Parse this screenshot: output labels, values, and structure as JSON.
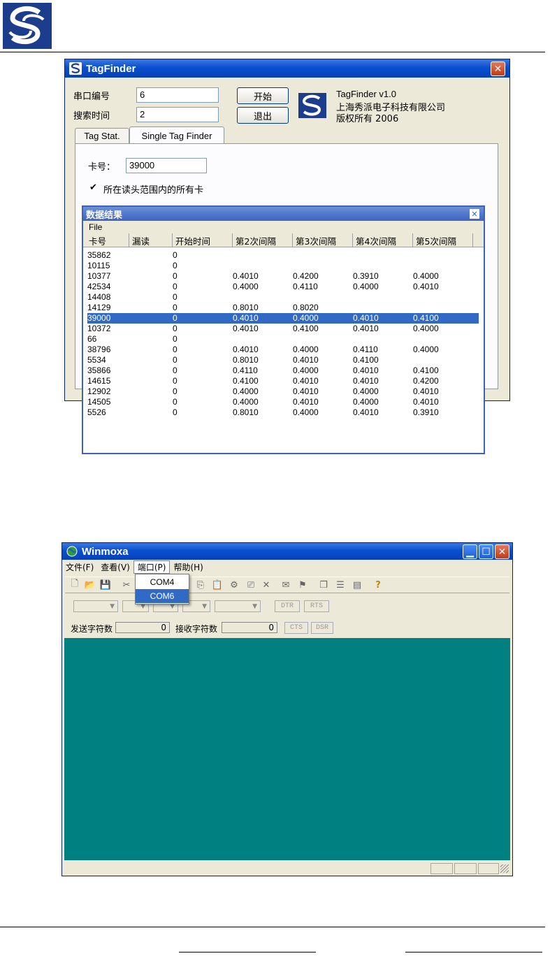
{
  "tagfinder": {
    "title": "TagFinder",
    "port_label": "串口编号",
    "port_value": "6",
    "search_time_label": "搜索时间",
    "search_time_value": "2",
    "start_button": "开始",
    "exit_button": "退出",
    "about_version": "TagFinder v1.0",
    "about_company": "上海秀派电子科技有限公司",
    "about_copyright": "版权所有 2006",
    "tabs": [
      "Tag Stat.",
      "Single Tag Finder"
    ],
    "card_label": "卡号：",
    "card_value": "39000",
    "checkbox_label": "所在读头范围内的所有卡"
  },
  "results": {
    "title": "数据结果",
    "menu_file": "File",
    "columns": [
      "卡号",
      "漏读",
      "开始时间",
      "第2次间隔",
      "第3次间隔",
      "第4次间隔",
      "第5次间隔"
    ],
    "rows": [
      [
        "35862",
        "",
        "0",
        "",
        "",
        "",
        ""
      ],
      [
        "10115",
        "",
        "0",
        "",
        "",
        "",
        ""
      ],
      [
        "10377",
        "",
        "0",
        "0.4010",
        "0.4200",
        "0.3910",
        "0.4000"
      ],
      [
        "42534",
        "",
        "0",
        "0.4000",
        "0.4110",
        "0.4000",
        "0.4010"
      ],
      [
        "14408",
        "",
        "0",
        "",
        "",
        "",
        ""
      ],
      [
        "14129",
        "",
        "0",
        "0.8010",
        "0.8020",
        "",
        ""
      ],
      [
        "39000",
        "",
        "0",
        "0.4010",
        "0.4000",
        "0.4010",
        "0.4100"
      ],
      [
        "10372",
        "",
        "0",
        "0.4010",
        "0.4100",
        "0.4010",
        "0.4000"
      ],
      [
        "66",
        "",
        "0",
        "",
        "",
        "",
        ""
      ],
      [
        "38796",
        "",
        "0",
        "0.4010",
        "0.4000",
        "0.4110",
        "0.4000"
      ],
      [
        "5534",
        "",
        "0",
        "0.8010",
        "0.4010",
        "0.4100",
        ""
      ],
      [
        "35866",
        "",
        "0",
        "0.4110",
        "0.4000",
        "0.4010",
        "0.4100"
      ],
      [
        "14615",
        "",
        "0",
        "0.4100",
        "0.4010",
        "0.4010",
        "0.4200"
      ],
      [
        "12902",
        "",
        "0",
        "0.4000",
        "0.4010",
        "0.4000",
        "0.4010"
      ],
      [
        "14505",
        "",
        "0",
        "0.4000",
        "0.4010",
        "0.4000",
        "0.4010"
      ],
      [
        "5526",
        "",
        "0",
        "0.8010",
        "0.4000",
        "0.4010",
        "0.3910"
      ]
    ],
    "selected_row": 6
  },
  "winmoxa": {
    "title": "Winmoxa",
    "menus": [
      "文件(F)",
      "查看(V)",
      "端口(P)",
      "帮助(H)"
    ],
    "port_menu_items": [
      "COM4",
      "COM6"
    ],
    "highlighted_item": 1,
    "dtr": "DTR",
    "rts": "RTS",
    "send_label": "发送字符数",
    "send_count": "0",
    "recv_label": "接收字符数",
    "recv_count": "0",
    "cts": "CTS",
    "dsr": "DSR",
    "help_glyph": "?"
  },
  "colors": {
    "xp_blue": "#0a4fcf",
    "selection": "#316ac5",
    "terminal_bg": "#008080"
  }
}
